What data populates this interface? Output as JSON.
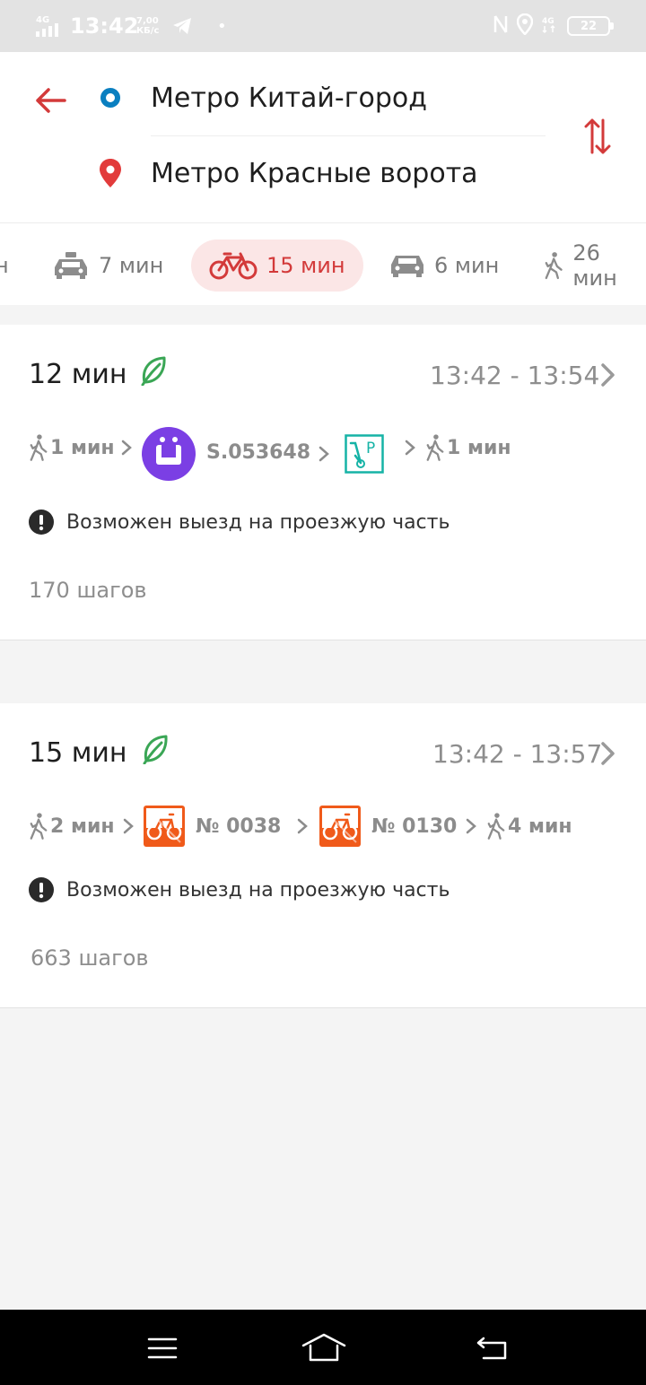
{
  "status_bar": {
    "network": "4G",
    "time": "13:42",
    "speed_value": "7,00",
    "speed_unit": "КБ/с",
    "battery": "22"
  },
  "route": {
    "from": "Метро Китай-город",
    "to": "Метро Красные ворота"
  },
  "modes": [
    {
      "icon": "transit-icon",
      "label": "н"
    },
    {
      "icon": "taxi-icon",
      "label": "7 мин"
    },
    {
      "icon": "bike-icon",
      "label": "15 мин",
      "active": true
    },
    {
      "icon": "car-icon",
      "label": "6 мин"
    },
    {
      "icon": "walk-icon",
      "label": "26 мин"
    }
  ],
  "results": [
    {
      "duration": "12 мин",
      "time_range": "13:42 - 13:54",
      "segments": {
        "walk1": "1 мин",
        "vehicle": "S.053648",
        "walk2": "1 мин"
      },
      "warning": "Возможен выезд на проезжую часть",
      "steps": "170 шагов"
    },
    {
      "duration": "15 мин",
      "time_range": "13:42 - 13:57",
      "segments": {
        "walk1": "2 мин",
        "bike1": "№ 0038",
        "bike2": "№ 0130",
        "walk2": "4 мин"
      },
      "warning": "Возможен выезд на проезжую часть",
      "steps": "663 шагов"
    }
  ],
  "colors": {
    "accent": "#d33a3a",
    "metro_blue": "#0a7fc0",
    "eco_green": "#3aa655",
    "kicksharing_purple": "#7b3fe4",
    "parking_teal": "#16b3a6",
    "bikeshare_orange": "#f05a1a"
  }
}
